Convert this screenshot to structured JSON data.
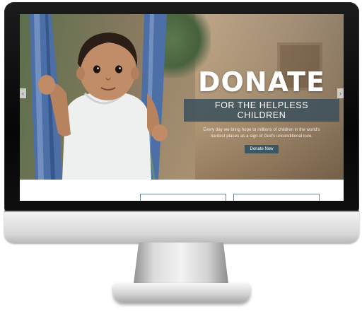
{
  "hero": {
    "title": "DONATE",
    "subtitle": "FOR THE HELPLESS CHILDREN",
    "description_line1": "Every day we bring hope to millions of children in the world's",
    "description_line2": "hardest places as a sign of God's unconditional love.",
    "cta_label": "Donate Now"
  },
  "slider": {
    "prev_icon": "chevron-left-icon",
    "next_icon": "chevron-right-icon",
    "prev_glyph": "‹",
    "next_glyph": "›"
  },
  "colors": {
    "accent": "#3d5663",
    "subtitle_bg": "#3a505c",
    "box_border": "#6a8593"
  }
}
